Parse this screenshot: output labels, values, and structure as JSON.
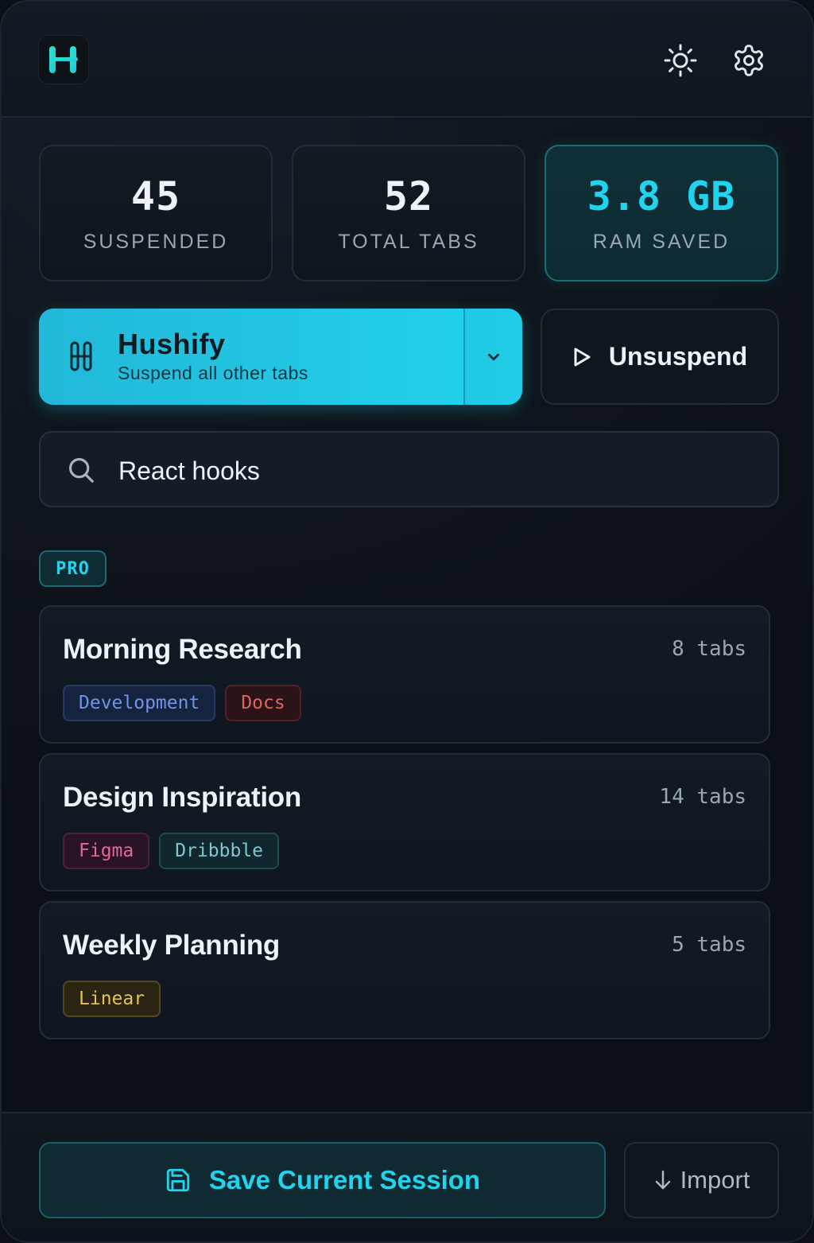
{
  "header": {
    "logo_icon": "hushify-logo-icon",
    "theme_icon": "sun-icon",
    "settings_icon": "gear-icon",
    "accent": "#22d3ee"
  },
  "stats": [
    {
      "value": "45",
      "label": "SUSPENDED"
    },
    {
      "value": "52",
      "label": "TOTAL TABS"
    },
    {
      "value": "3.8 GB",
      "label": "RAM SAVED"
    }
  ],
  "actions": {
    "hushify_title": "Hushify",
    "hushify_subtitle": "Suspend all other tabs",
    "unsuspend_label": "Unsuspend"
  },
  "search": {
    "value": "React hooks",
    "placeholder": ""
  },
  "pro_badge": "PRO",
  "sessions": [
    {
      "title": "Morning Research",
      "count": "8 tabs",
      "tags": [
        {
          "label": "Development",
          "color": "#6f95e6"
        },
        {
          "label": "Docs",
          "color": "#e0645e"
        }
      ]
    },
    {
      "title": "Design Inspiration",
      "count": "14 tabs",
      "tags": [
        {
          "label": "Figma",
          "color": "#e2679a"
        },
        {
          "label": "Dribbble",
          "color": "#7fc6cf"
        }
      ]
    },
    {
      "title": "Weekly Planning",
      "count": "5 tabs",
      "tags": [
        {
          "label": "Linear",
          "color": "#e3c25a"
        }
      ]
    }
  ],
  "footer": {
    "save_label": "Save Current Session",
    "import_label": "Import"
  }
}
